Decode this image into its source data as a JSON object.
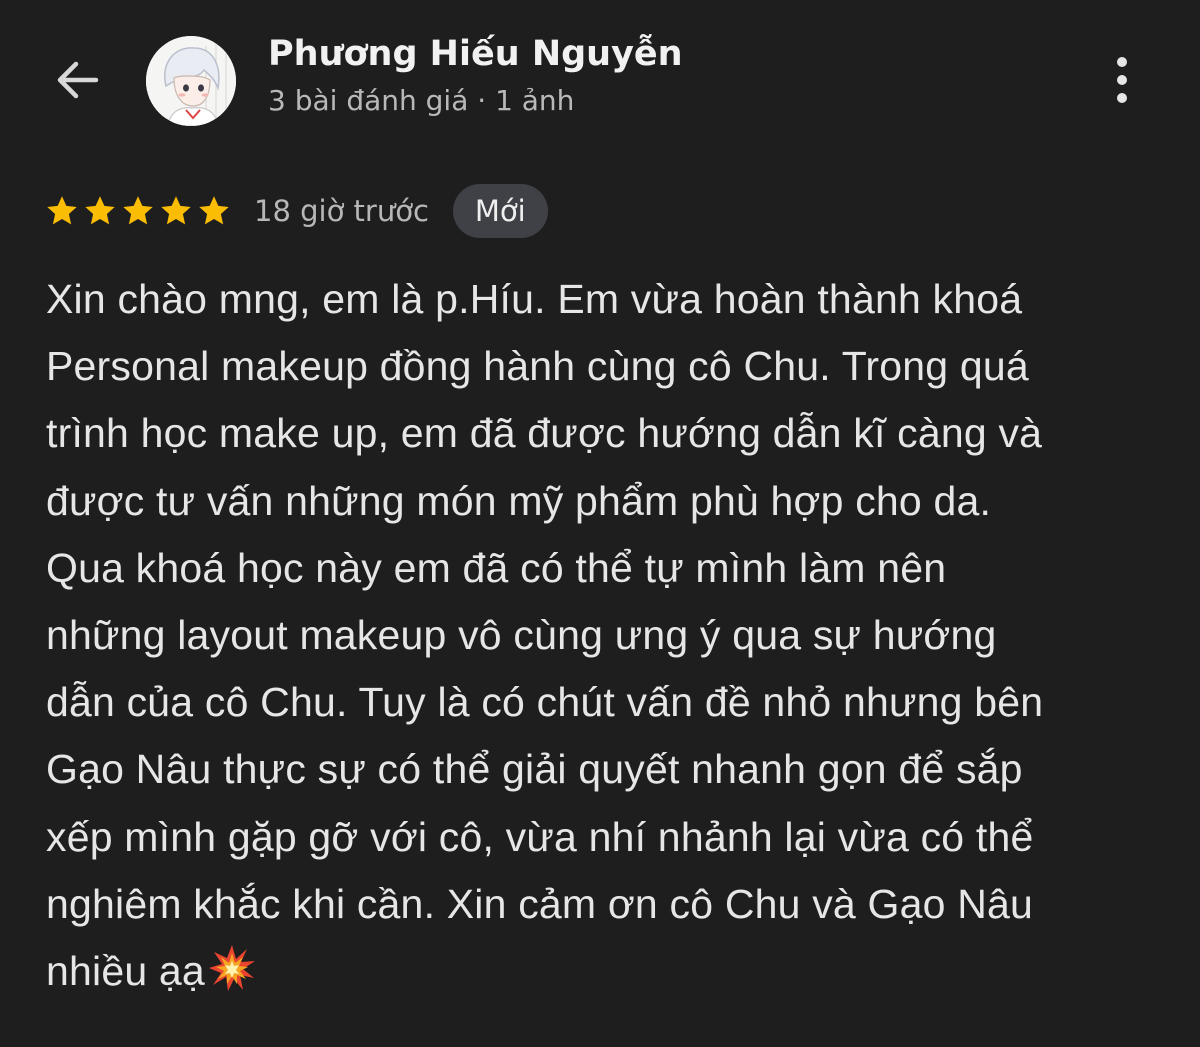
{
  "header": {
    "back_icon": "arrow-left-icon",
    "avatar_icon": "avatar-anime-boy",
    "name": "Phương Hiếu Nguyễn",
    "subline": "3 bài đánh giá · 1 ảnh",
    "more_icon": "more-vertical-icon"
  },
  "review": {
    "rating": 5,
    "rating_max": 5,
    "star_color": "#fbbc04",
    "time": "18 giờ trước",
    "badge": "Mới",
    "lines": [
      "Xin chào mng, em là p.Híu. Em vừa hoàn thành khoá",
      "Personal makeup đồng hành cùng cô Chu. Trong quá",
      "trình học make up, em đã được hướng dẫn kĩ càng và",
      "được tư vấn những món mỹ phẩm phù hợp cho da.",
      "Qua khoá học này em đã có thể tự mình làm nên",
      "những layout makeup vô cùng ưng ý qua sự hướng",
      "dẫn của cô Chu. Tuy là có chút vấn đề nhỏ nhưng bên",
      "Gạo Nâu thực sự có thể giải quyết nhanh gọn để sắp",
      "xếp mình gặp gỡ với cô, vừa nhí nhảnh lại vừa có thể",
      "nghiêm khắc khi cần. Xin cảm ơn cô Chu và Gạo Nâu",
      "nhiều ạạ"
    ],
    "end_emoji": "collision-emoji"
  }
}
